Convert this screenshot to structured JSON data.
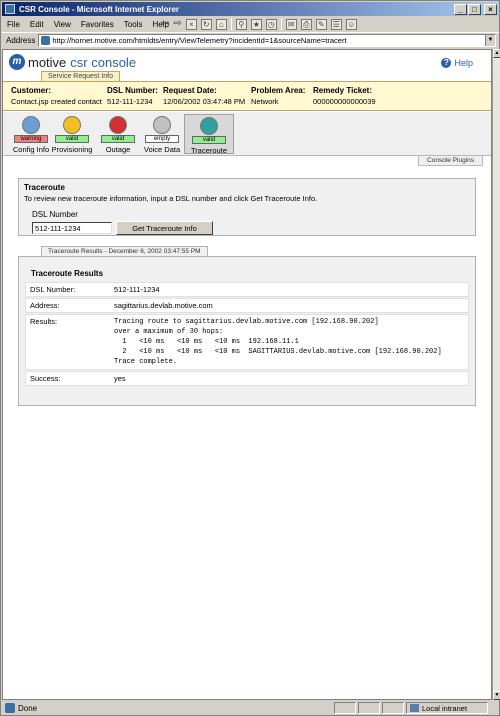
{
  "window": {
    "title": "CSR Console - Microsoft Internet Explorer"
  },
  "menu": [
    "File",
    "Edit",
    "View",
    "Favorites",
    "Tools",
    "Help"
  ],
  "address": {
    "label": "Address",
    "url": "http://hornet.motive.com/htmldts/entry/ViewTelemetry?incidentId=1&sourceName=tracert"
  },
  "brand": {
    "logo_letter": "m",
    "name": "motive",
    "product": "csr console"
  },
  "help": {
    "label": "Help"
  },
  "service_request": {
    "tab_label": "Service Request Info",
    "fields": [
      {
        "label": "Customer:",
        "value": "Contact.jsp created contact"
      },
      {
        "label": "DSL Number:",
        "value": "512-111-1234"
      },
      {
        "label": "Request Date:",
        "value": "12/06/2002 03:47:48 PM"
      },
      {
        "label": "Problem Area:",
        "value": "Network"
      },
      {
        "label": "Remedy Ticket:",
        "value": "000000000000039"
      }
    ]
  },
  "plugins": [
    {
      "label": "Config Info",
      "badge": "warning",
      "badge_color": "#f08080",
      "icon_color": "#6a9fd8"
    },
    {
      "label": "Provisioning",
      "badge": "valid",
      "badge_color": "#90ee90",
      "icon_color": "#f0c020"
    },
    {
      "label": "Outage",
      "badge": "valid",
      "badge_color": "#90ee90",
      "icon_color": "#d03030"
    },
    {
      "label": "Voice Data",
      "badge": "empty",
      "badge_color": "#ffffff",
      "icon_color": "#c0c0c0"
    },
    {
      "label": "Traceroute",
      "badge": "valid",
      "badge_color": "#90ee90",
      "icon_color": "#30a0a0"
    }
  ],
  "console_plugins_tab": "Console Plugins",
  "traceroute": {
    "title": "Traceroute",
    "description": "To review new traceroute information, input a DSL number and click Get Traceroute Info.",
    "dsl_label": "DSL Number",
    "dsl_value": "512-111-1234",
    "button_label": "Get Traceroute Info"
  },
  "results": {
    "tab_label": "Traceroute Results - December 6, 2002 03:47:55 PM",
    "title": "Traceroute Results",
    "rows": [
      {
        "key": "DSL Number:",
        "value": "512-111-1234"
      },
      {
        "key": "Address:",
        "value": "sagittarius.devlab.motive.com"
      },
      {
        "key": "Results:",
        "value": "Tracing route to sagittarius.devlab.motive.com [192.168.90.202]\nover a maximum of 30 hops:\n  1   <10 ms   <10 ms   <10 ms  192.168.11.1\n  2   <10 ms   <10 ms   <10 ms  SAGITTARIUS.devlab.motive.com [192.168.90.202]\nTrace complete."
      },
      {
        "key": "Success:",
        "value": "yes"
      }
    ]
  },
  "status": {
    "text": "Done",
    "zone": "Local intranet"
  }
}
